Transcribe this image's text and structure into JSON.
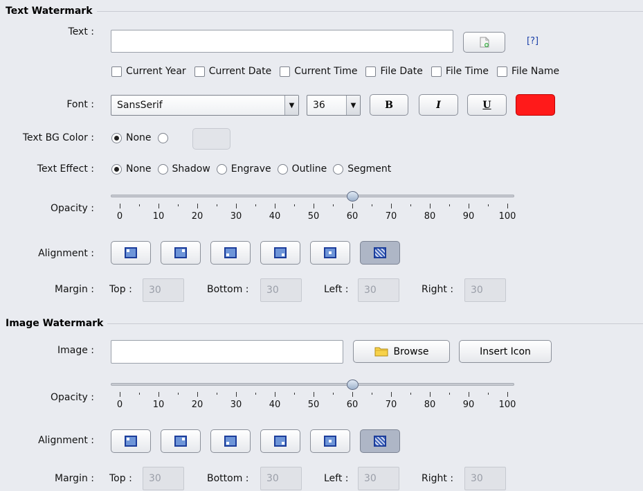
{
  "text_watermark": {
    "section_title": "Text Watermark",
    "text_label": "Text :",
    "text_value": "",
    "help_link": "[?]",
    "checkboxes": [
      "Current Year",
      "Current Date",
      "Current Time",
      "File Date",
      "File Time",
      "File Name"
    ],
    "font_label": "Font :",
    "font_family": "SansSerif",
    "font_size": "36",
    "bold_label": "B",
    "italic_label": "I",
    "underline_label": "U",
    "text_color": "#ff1a1a",
    "bg_color_label": "Text BG Color :",
    "bg_options": [
      "None"
    ],
    "effect_label": "Text Effect :",
    "effects": [
      "None",
      "Shadow",
      "Engrave",
      "Outline",
      "Segment"
    ],
    "opacity_label": "Opacity :",
    "opacity_value": 60,
    "opacity_ticks": [
      "0",
      "10",
      "20",
      "30",
      "40",
      "50",
      "60",
      "70",
      "80",
      "90",
      "100"
    ],
    "alignment_label": "Alignment :",
    "margin_label": "Margin :",
    "margin": {
      "top_label": "Top :",
      "top": "30",
      "bottom_label": "Bottom :",
      "bottom": "30",
      "left_label": "Left :",
      "left": "30",
      "right_label": "Right :",
      "right": "30"
    }
  },
  "image_watermark": {
    "section_title": "Image Watermark",
    "image_label": "Image :",
    "image_value": "",
    "browse_label": "Browse",
    "insert_icon_label": "Insert Icon",
    "opacity_label": "Opacity :",
    "opacity_value": 60,
    "opacity_ticks": [
      "0",
      "10",
      "20",
      "30",
      "40",
      "50",
      "60",
      "70",
      "80",
      "90",
      "100"
    ],
    "alignment_label": "Alignment :",
    "margin_label": "Margin :",
    "margin": {
      "top_label": "Top :",
      "top": "30",
      "bottom_label": "Bottom :",
      "bottom": "30",
      "left_label": "Left :",
      "left": "30",
      "right_label": "Right :",
      "right": "30"
    }
  },
  "colors": {
    "accent": "#1b3c9a",
    "icon_fill": "#6e95d8"
  }
}
